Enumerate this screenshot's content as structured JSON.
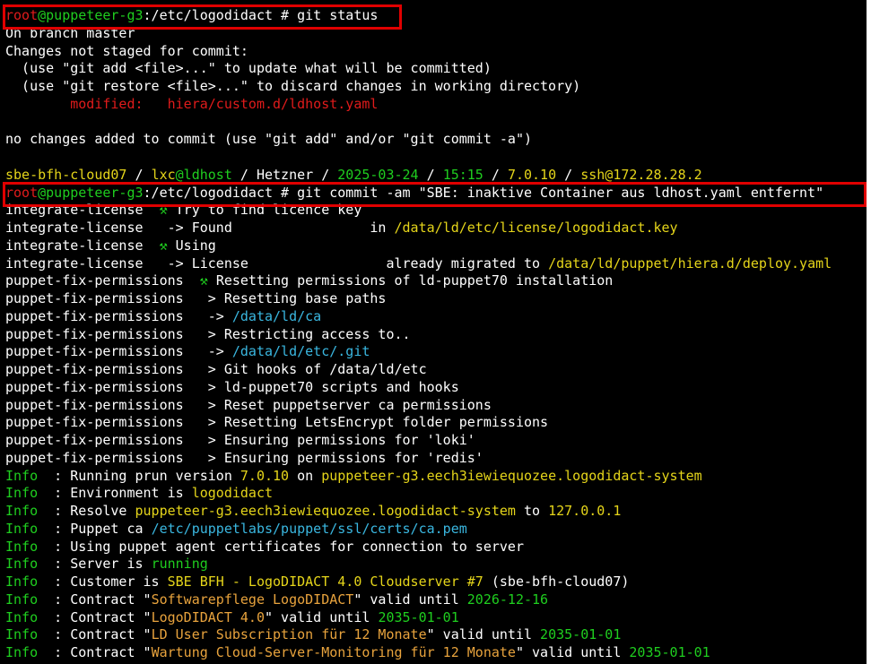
{
  "terminal": {
    "lines": [
      [
        [
          "r",
          "root"
        ],
        [
          "g",
          "@puppeteer-g3"
        ],
        [
          "w",
          ":/etc/logodidact # git status"
        ]
      ],
      [
        [
          "w",
          "On branch master"
        ]
      ],
      [
        [
          "w",
          "Changes not staged for commit:"
        ]
      ],
      [
        [
          "w",
          "  (use \"git add <file>...\" to update what will be committed)"
        ]
      ],
      [
        [
          "w",
          "  (use \"git restore <file>...\" to discard changes in working directory)"
        ]
      ],
      [
        [
          "w",
          "        "
        ],
        [
          "r",
          "modified:   hiera/custom.d/ldhost.yaml"
        ]
      ],
      [
        [
          "w",
          ""
        ]
      ],
      [
        [
          "w",
          "no changes added to commit (use \"git add\" and/or \"git commit -a\")"
        ]
      ],
      [
        [
          "w",
          ""
        ]
      ],
      [
        [
          "y",
          "sbe-bfh-cloud07"
        ],
        [
          "w",
          " / "
        ],
        [
          "y",
          "lxc"
        ],
        [
          "g",
          "@ldhost"
        ],
        [
          "w",
          " / "
        ],
        [
          "w",
          "Hetzner"
        ],
        [
          "w",
          " / "
        ],
        [
          "g",
          "2025-03-24"
        ],
        [
          "w",
          " / "
        ],
        [
          "g",
          "15:15"
        ],
        [
          "w",
          " / "
        ],
        [
          "y",
          "7.0.10"
        ],
        [
          "w",
          " / "
        ],
        [
          "y",
          "ssh@172.28.28.2"
        ]
      ],
      [
        [
          "r",
          "root"
        ],
        [
          "g",
          "@puppeteer-g3"
        ],
        [
          "w",
          ":/etc/logodidact # git commit -am \"SBE: inaktive Container aus ldhost.yaml entfernt\""
        ]
      ],
      [
        [
          "w",
          "integrate-license  "
        ],
        [
          "g",
          "⚒ "
        ],
        [
          "w",
          "Try to find licence key"
        ]
      ],
      [
        [
          "w",
          "integrate-license   "
        ],
        [
          "w",
          "-> Found                 in "
        ],
        [
          "y",
          "/data/ld/etc/license/logodidact.key"
        ]
      ],
      [
        [
          "w",
          "integrate-license  "
        ],
        [
          "g",
          "⚒ "
        ],
        [
          "w",
          "Using"
        ]
      ],
      [
        [
          "w",
          "integrate-license   "
        ],
        [
          "w",
          "-> License                 already migrated to "
        ],
        [
          "y",
          "/data/ld/puppet/hiera.d/deploy.yaml"
        ]
      ],
      [
        [
          "w",
          "puppet-fix-permissions  "
        ],
        [
          "g",
          "⚒ "
        ],
        [
          "w",
          "Resetting permissions of ld-puppet70 installation"
        ]
      ],
      [
        [
          "w",
          "puppet-fix-permissions   "
        ],
        [
          "w",
          "> Resetting base paths"
        ]
      ],
      [
        [
          "w",
          "puppet-fix-permissions   "
        ],
        [
          "w",
          "-> "
        ],
        [
          "c",
          "/data/ld/ca"
        ]
      ],
      [
        [
          "w",
          "puppet-fix-permissions   "
        ],
        [
          "w",
          "> Restricting access to.."
        ]
      ],
      [
        [
          "w",
          "puppet-fix-permissions   "
        ],
        [
          "w",
          "-> "
        ],
        [
          "c",
          "/data/ld/etc/.git"
        ]
      ],
      [
        [
          "w",
          "puppet-fix-permissions   "
        ],
        [
          "w",
          "> Git hooks of /data/ld/etc"
        ]
      ],
      [
        [
          "w",
          "puppet-fix-permissions   "
        ],
        [
          "w",
          "> ld-puppet70 scripts and hooks"
        ]
      ],
      [
        [
          "w",
          "puppet-fix-permissions   "
        ],
        [
          "w",
          "> Reset puppetserver ca permissions"
        ]
      ],
      [
        [
          "w",
          "puppet-fix-permissions   "
        ],
        [
          "w",
          "> Resetting LetsEncrypt folder permissions"
        ]
      ],
      [
        [
          "w",
          "puppet-fix-permissions   "
        ],
        [
          "w",
          "> Ensuring permissions for 'loki'"
        ]
      ],
      [
        [
          "w",
          "puppet-fix-permissions   "
        ],
        [
          "w",
          "> Ensuring permissions for 'redis'"
        ]
      ],
      [
        [
          "g",
          "Info"
        ],
        [
          "w",
          "  : Running prun version "
        ],
        [
          "y",
          "7.0.10"
        ],
        [
          "w",
          " on "
        ],
        [
          "y",
          "puppeteer-g3.eech3iewiequozee.logodidact-system"
        ]
      ],
      [
        [
          "g",
          "Info"
        ],
        [
          "w",
          "  : Environment is "
        ],
        [
          "y",
          "logodidact"
        ]
      ],
      [
        [
          "g",
          "Info"
        ],
        [
          "w",
          "  : Resolve "
        ],
        [
          "y",
          "puppeteer-g3.eech3iewiequozee.logodidact-system"
        ],
        [
          "w",
          " to "
        ],
        [
          "y",
          "127.0.0.1"
        ]
      ],
      [
        [
          "g",
          "Info"
        ],
        [
          "w",
          "  : Puppet ca "
        ],
        [
          "c",
          "/etc/puppetlabs/puppet/ssl/certs/ca.pem"
        ]
      ],
      [
        [
          "g",
          "Info"
        ],
        [
          "w",
          "  : Using puppet agent certificates for connection to server"
        ]
      ],
      [
        [
          "g",
          "Info"
        ],
        [
          "w",
          "  : Server is "
        ],
        [
          "g",
          "running"
        ]
      ],
      [
        [
          "g",
          "Info"
        ],
        [
          "w",
          "  : Customer is "
        ],
        [
          "y",
          "SBE BFH - LogoDIDACT 4.0 Cloudserver #7"
        ],
        [
          "w",
          " (sbe-bfh-cloud07)"
        ]
      ],
      [
        [
          "g",
          "Info"
        ],
        [
          "w",
          "  : Contract \""
        ],
        [
          "o",
          "Softwarepflege LogoDIDACT"
        ],
        [
          "w",
          "\" valid until "
        ],
        [
          "g",
          "2026-12-16"
        ]
      ],
      [
        [
          "g",
          "Info"
        ],
        [
          "w",
          "  : Contract \""
        ],
        [
          "o",
          "LogoDIDACT 4.0"
        ],
        [
          "w",
          "\" valid until "
        ],
        [
          "g",
          "2035-01-01"
        ]
      ],
      [
        [
          "g",
          "Info"
        ],
        [
          "w",
          "  : Contract \""
        ],
        [
          "o",
          "LD User Subscription für 12 Monate"
        ],
        [
          "w",
          "\" valid until "
        ],
        [
          "g",
          "2035-01-01"
        ]
      ],
      [
        [
          "g",
          "Info"
        ],
        [
          "w",
          "  : Contract \""
        ],
        [
          "o",
          "Wartung Cloud-Server-Monitoring für 12 Monate"
        ],
        [
          "w",
          "\" valid until "
        ],
        [
          "g",
          "2035-01-01"
        ]
      ]
    ]
  }
}
